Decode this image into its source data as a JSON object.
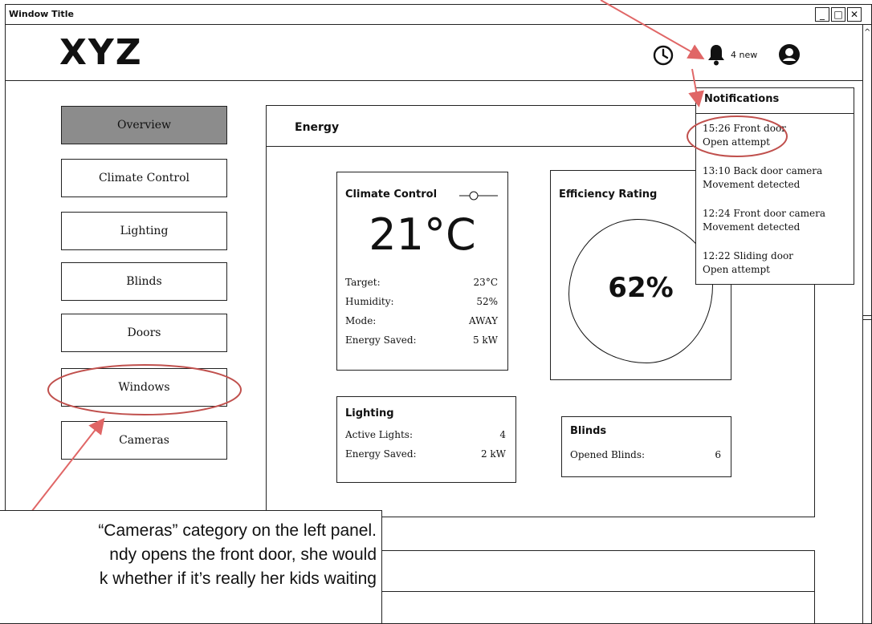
{
  "window": {
    "title": "Window Title",
    "min_glyph": "_",
    "max_glyph": "□",
    "close_glyph": "✕"
  },
  "header": {
    "logo": "XYZ",
    "notification_count": "4 new"
  },
  "sidebar": {
    "items": [
      {
        "label": "Overview",
        "active": true
      },
      {
        "label": "Climate Control"
      },
      {
        "label": "Lighting"
      },
      {
        "label": "Blinds"
      },
      {
        "label": "Doors"
      },
      {
        "label": "Windows"
      },
      {
        "label": "Cameras"
      }
    ]
  },
  "main": {
    "panel_title": "Energy",
    "climate": {
      "title": "Climate Control",
      "temperature": "21°C",
      "rows": [
        {
          "label": "Target:",
          "value": "23°C"
        },
        {
          "label": "Humidity:",
          "value": "52%"
        },
        {
          "label": "Mode:",
          "value": "AWAY"
        },
        {
          "label": "Energy Saved:",
          "value": "5 kW"
        }
      ]
    },
    "efficiency": {
      "title": "Efficiency Rating",
      "value": "62%"
    },
    "lighting": {
      "title": "Lighting",
      "rows": [
        {
          "label": "Active Lights:",
          "value": "4"
        },
        {
          "label": "Energy Saved:",
          "value": "2 kW"
        }
      ]
    },
    "blinds": {
      "title": "Blinds",
      "rows": [
        {
          "label": "Opened Blinds:",
          "value": "6"
        }
      ]
    }
  },
  "notifications": {
    "title": "Notifications",
    "items": [
      {
        "line1": "15:26 Front door",
        "line2": "Open attempt"
      },
      {
        "line1": "13:10 Back door camera",
        "line2": "Movement detected"
      },
      {
        "line1": "12:24 Front door camera",
        "line2": "Movement detected"
      },
      {
        "line1": "12:22 Sliding door",
        "line2": "Open attempt"
      }
    ]
  },
  "annotation": {
    "lines": [
      "“Cameras” category on the left panel.",
      "ndy opens the front door, she would",
      "k whether if it’s really her kids waiting"
    ]
  },
  "colors": {
    "highlight": "#c0504d",
    "active_nav": "#8c8c8c"
  }
}
